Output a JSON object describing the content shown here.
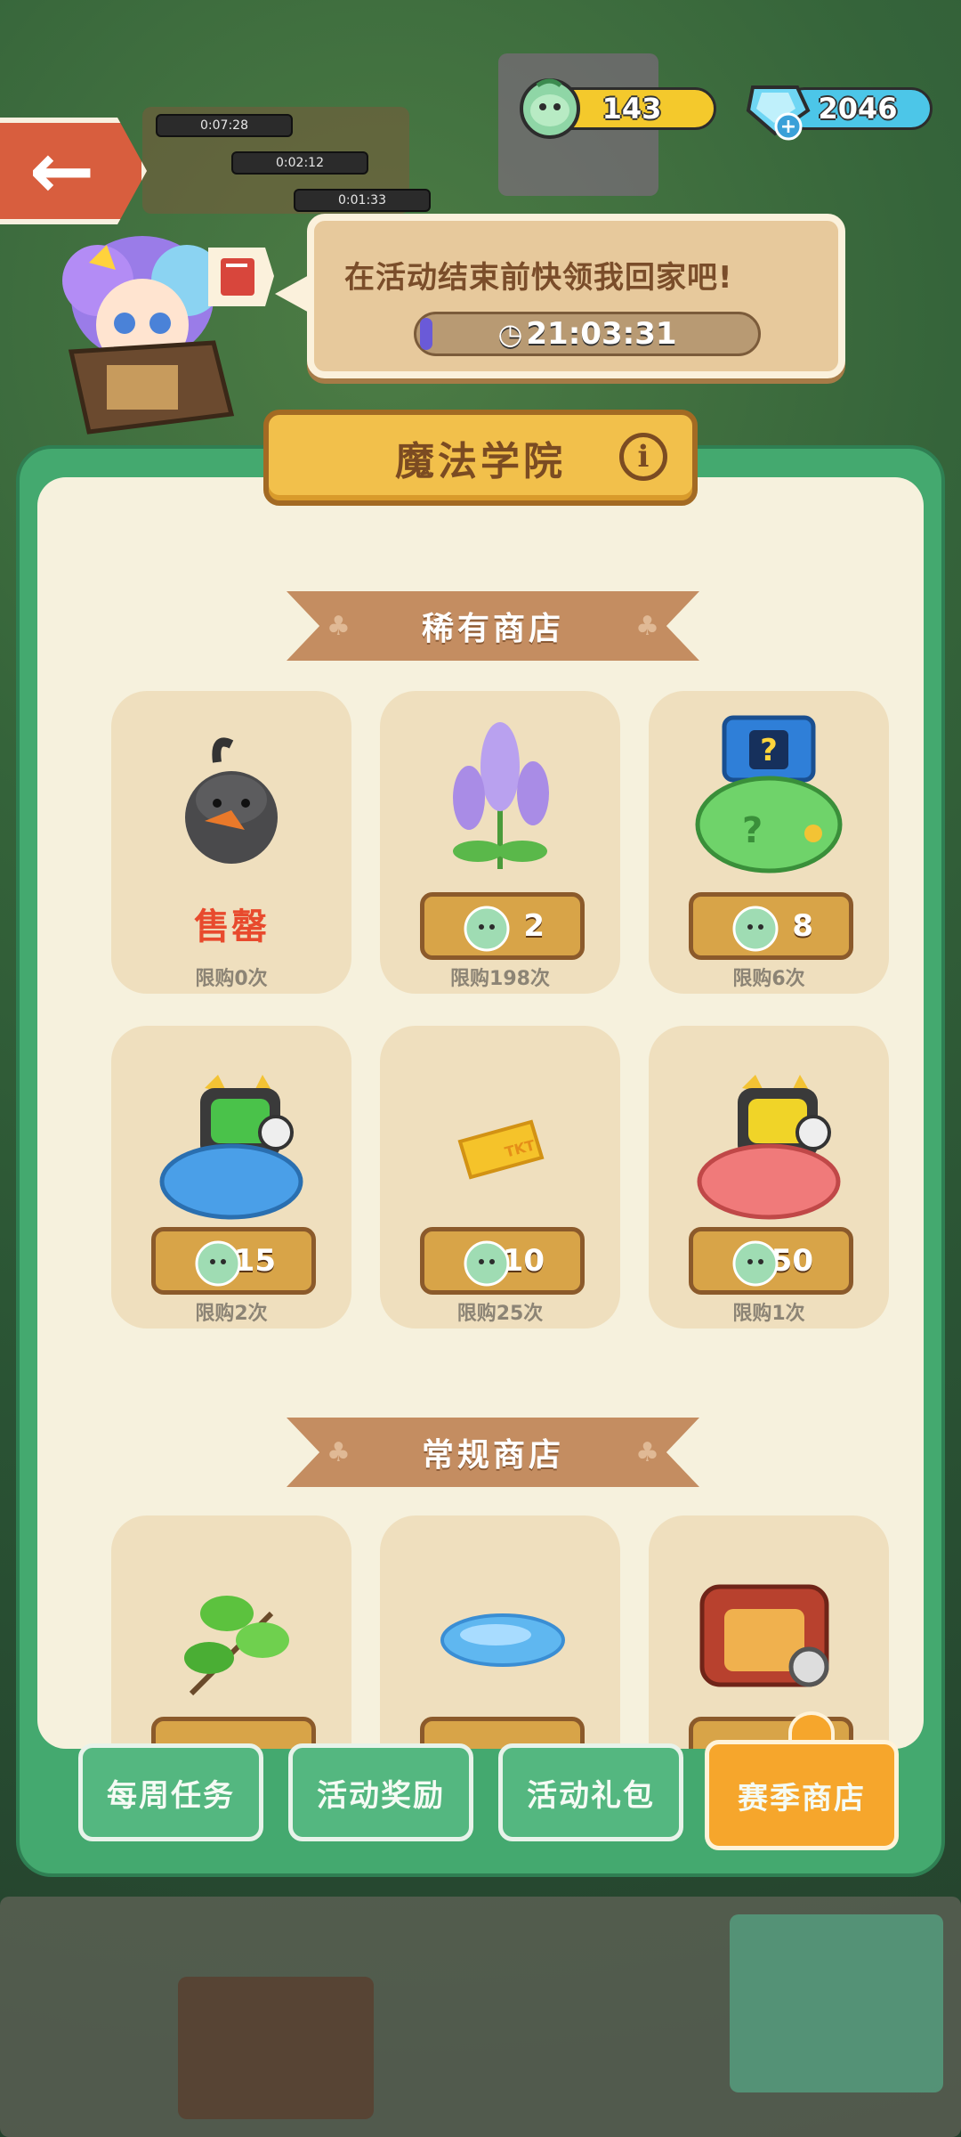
{
  "header": {
    "coins": "143",
    "gems": "2046",
    "back_label": "←"
  },
  "bg_timers": [
    "0:07:28",
    "0:02:12",
    "0:01:33"
  ],
  "speech": {
    "text": "在活动结束前快领我回家吧!",
    "timer": "21:03:31",
    "progress": 0.03
  },
  "panel": {
    "title": "魔法学院",
    "info_icon": "info-icon"
  },
  "rare_shop": {
    "title": "稀有商店",
    "items": [
      {
        "icon": "black-duck-icon",
        "price": "",
        "soldout": "售罄",
        "limit": "限购0次"
      },
      {
        "icon": "lavender-flower-icon",
        "price": "2",
        "limit": "限购198次"
      },
      {
        "icon": "green-mystery-bag-icon",
        "price": "8",
        "limit": "限购6次"
      },
      {
        "icon": "blue-robot-cat-bag-icon",
        "price": "15",
        "limit": "限购2次"
      },
      {
        "icon": "gold-ticket-icon",
        "price": "10",
        "limit": "限购25次"
      },
      {
        "icon": "red-robot-cat-bag-icon",
        "price": "50",
        "limit": "限购1次"
      }
    ]
  },
  "normal_shop": {
    "title": "常规商店",
    "items": [
      {
        "icon": "green-leaf-branch-icon"
      },
      {
        "icon": "blue-puddle-icon"
      },
      {
        "icon": "red-radio-icon"
      }
    ]
  },
  "tabs": [
    {
      "label": "每周任务"
    },
    {
      "label": "活动奖励"
    },
    {
      "label": "活动礼包"
    },
    {
      "label": "赛季商店",
      "active": true
    }
  ]
}
